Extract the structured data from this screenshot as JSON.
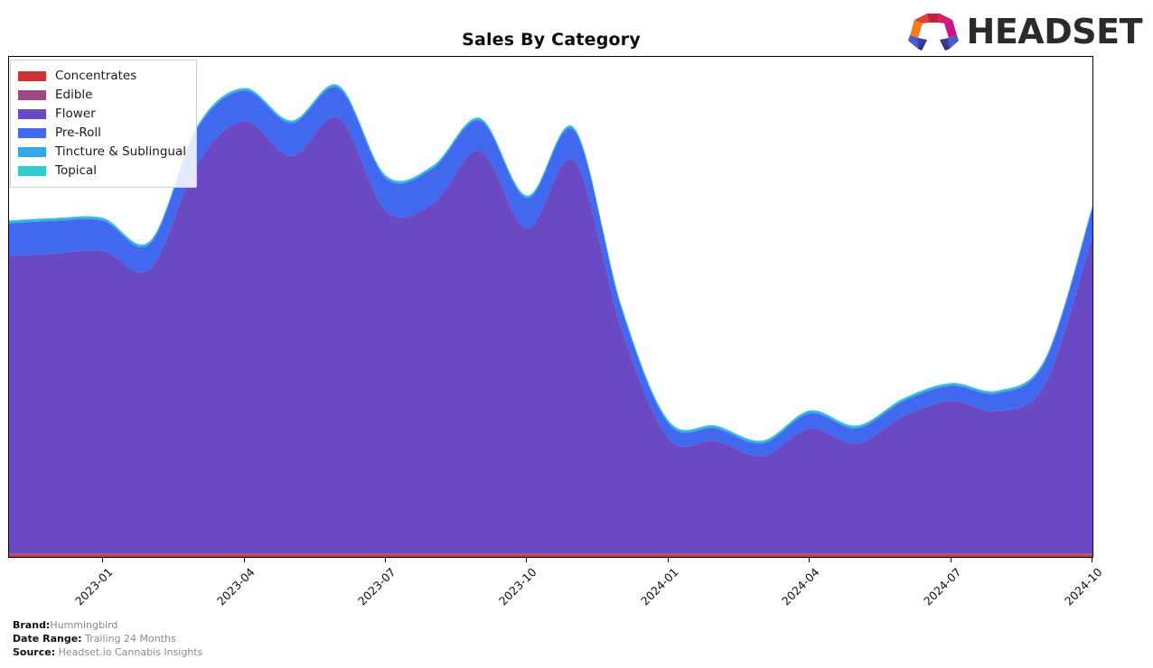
{
  "header": {
    "title": "Sales By Category",
    "brand_wordmark": "HEADSET",
    "logo_icon": "headset-logo-icon"
  },
  "legend": {
    "position": "upper-left",
    "items": [
      {
        "label": "Concentrates",
        "color": "#cc3333"
      },
      {
        "label": "Edible",
        "color": "#9b4a87"
      },
      {
        "label": "Flower",
        "color": "#6a4ac4"
      },
      {
        "label": "Pre-Roll",
        "color": "#4169f0"
      },
      {
        "label": "Tincture & Sublingual",
        "color": "#38a5e8"
      },
      {
        "label": "Topical",
        "color": "#33cccc"
      }
    ]
  },
  "footer": {
    "rows": [
      {
        "key": "Brand:",
        "value": "Hummingbird"
      },
      {
        "key": "Date Range:",
        "value": "Trailing 24 Months"
      },
      {
        "key": "Source:",
        "value": "Headset.io Cannabis Insights"
      }
    ]
  },
  "chart_data": {
    "type": "area",
    "stacked": true,
    "title": "Sales By Category",
    "xlabel": "",
    "ylabel": "",
    "grid": false,
    "legend_position": "upper-left",
    "ylim": [
      0,
      100
    ],
    "y_units": "percent of sales",
    "x": [
      "2022-11",
      "2022-12",
      "2023-01",
      "2023-02",
      "2023-03",
      "2023-04",
      "2023-05",
      "2023-06",
      "2023-07",
      "2023-08",
      "2023-09",
      "2023-10",
      "2023-11",
      "2023-12",
      "2024-01",
      "2024-02",
      "2024-03",
      "2024-04",
      "2024-05",
      "2024-06",
      "2024-07",
      "2024-08",
      "2024-09",
      "2024-10"
    ],
    "xticklabels": [
      "2023-01",
      "2023-04",
      "2023-07",
      "2023-10",
      "2024-01",
      "2024-04",
      "2024-07",
      "2024-10"
    ],
    "series": [
      {
        "name": "Concentrates",
        "color": "#cc3333",
        "values": [
          0.4,
          0.4,
          0.4,
          0.4,
          0.4,
          0.4,
          0.4,
          0.4,
          0.4,
          0.4,
          0.4,
          0.4,
          0.4,
          0.4,
          0.4,
          0.4,
          0.4,
          0.4,
          0.4,
          0.4,
          0.4,
          0.4,
          0.4,
          0.4
        ]
      },
      {
        "name": "Edible",
        "color": "#9b4a87",
        "values": [
          0.3,
          0.3,
          0.3,
          0.3,
          0.3,
          0.3,
          0.3,
          0.3,
          0.3,
          0.3,
          0.3,
          0.3,
          0.3,
          0.3,
          0.3,
          0.3,
          0.3,
          0.3,
          0.3,
          0.3,
          0.3,
          0.3,
          0.3,
          0.3
        ]
      },
      {
        "name": "Flower",
        "color": "#6a4ac4",
        "values": [
          59.5,
          60.0,
          60.5,
          57.0,
          78.0,
          86.5,
          79.5,
          87.0,
          68.5,
          70.0,
          80.5,
          65.0,
          78.5,
          45.0,
          23.0,
          22.5,
          19.5,
          25.0,
          22.0,
          27.5,
          30.5,
          28.5,
          34.0,
          63.5
        ]
      },
      {
        "name": "Pre-Roll",
        "color": "#4169f0",
        "values": [
          6.5,
          6.5,
          6.0,
          5.0,
          7.0,
          6.0,
          6.5,
          6.0,
          6.5,
          7.0,
          6.0,
          6.0,
          6.0,
          4.0,
          3.0,
          2.5,
          2.5,
          3.0,
          3.0,
          3.0,
          3.0,
          3.5,
          4.5,
          5.5
        ]
      },
      {
        "name": "Tincture & Sublingual",
        "color": "#38a5e8",
        "values": [
          0.35,
          0.35,
          0.35,
          0.35,
          0.35,
          0.35,
          0.35,
          0.35,
          0.35,
          0.35,
          0.35,
          0.35,
          0.35,
          0.35,
          0.35,
          0.35,
          0.35,
          0.35,
          0.35,
          0.35,
          0.35,
          0.35,
          0.35,
          0.35
        ]
      },
      {
        "name": "Topical",
        "color": "#33cccc",
        "values": [
          0.25,
          0.25,
          0.25,
          0.25,
          0.25,
          0.25,
          0.25,
          0.25,
          0.25,
          0.25,
          0.25,
          0.25,
          0.25,
          0.25,
          0.25,
          0.25,
          0.25,
          0.25,
          0.25,
          0.25,
          0.25,
          0.25,
          0.25,
          0.25
        ]
      }
    ]
  }
}
